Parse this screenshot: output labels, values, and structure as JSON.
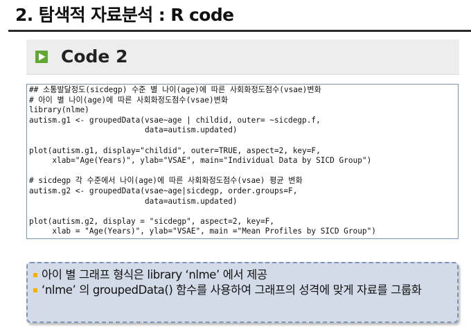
{
  "page": {
    "title": "2. 탐색적 자료분석 : R code"
  },
  "section": {
    "label": "Code 2",
    "icon": "play-square-icon",
    "icon_color": "#5fa832"
  },
  "code": {
    "lines": [
      "## 소통발달정도(sicdegp) 수준 별 나이(age)에 따른 사회화정도점수(vsae)변화",
      "# 아이 별 나이(age)에 따른 사회화정도점수(vsae)변화",
      "library(nlme)",
      "autism.g1 <- groupedData(vsae~age | childid, outer= ~sicdegp.f,",
      "                         data=autism.updated)",
      "",
      "plot(autism.g1, display=\"childid\", outer=TRUE, aspect=2, key=F,",
      "     xlab=\"Age(Years)\", ylab=\"VSAE\", main=\"Individual Data by SICD Group\")",
      "",
      "# sicdegp 각 수준에서 나이(age)에 따른 사회화정도점수(vsae) 평균 변화",
      "autism.g2 <- groupedData(vsae~age|sicdegp, order.groups=F,",
      "                         data=autism.updated)",
      "",
      "plot(autism.g2, display = \"sicdegp\", aspect=2, key=F,",
      "     xlab = \"Age(Years)\", ylab=\"VSAE\", main =\"Mean Profiles by SICD Group\")"
    ]
  },
  "summary": {
    "bullet_color": "#f2b200",
    "items": [
      "아이 별 그래프  형식은 library ‘nlme’ 에서 제공",
      "‘nlme’ 의 groupedData() 함수를  사용하여 그래프의 성격에 맞게 자료를 그룹화"
    ]
  }
}
